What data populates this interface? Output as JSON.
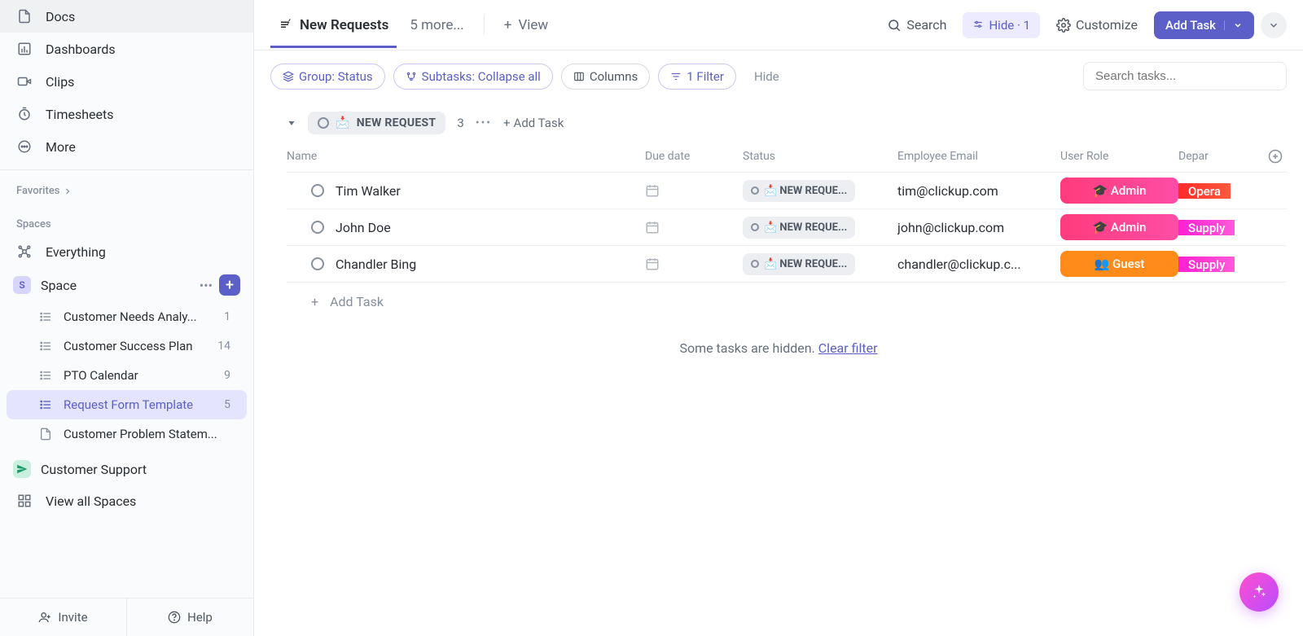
{
  "sidebar": {
    "nav": [
      {
        "icon": "doc",
        "label": "Docs"
      },
      {
        "icon": "dashboard",
        "label": "Dashboards"
      },
      {
        "icon": "clip",
        "label": "Clips"
      },
      {
        "icon": "timesheet",
        "label": "Timesheets"
      },
      {
        "icon": "more",
        "label": "More"
      }
    ],
    "favorites_label": "Favorites",
    "spaces_label": "Spaces",
    "everything_label": "Everything",
    "space": {
      "badge": "S",
      "badge_bg": "#d7d5fb",
      "badge_color": "#5b5fc7",
      "name": "Space"
    },
    "lists": [
      {
        "icon": "list",
        "label": "Customer Needs Analy...",
        "count": "1",
        "active": false
      },
      {
        "icon": "list",
        "label": "Customer Success Plan",
        "count": "14",
        "active": false
      },
      {
        "icon": "list",
        "label": "PTO Calendar",
        "count": "9",
        "active": false
      },
      {
        "icon": "list",
        "label": "Request Form Template",
        "count": "5",
        "active": true
      },
      {
        "icon": "doc",
        "label": "Customer Problem Statem...",
        "count": "",
        "active": false
      }
    ],
    "customer_support": {
      "label": "Customer Support",
      "badge_bg": "#c9f0df"
    },
    "view_all_spaces": "View all Spaces",
    "footer": {
      "invite": "Invite",
      "help": "Help"
    }
  },
  "tabs": {
    "active_label": "New Requests",
    "more_label": "5 more...",
    "view_label": "View"
  },
  "topbar": {
    "search": "Search",
    "hide": "Hide · 1",
    "customize": "Customize",
    "add_task": "Add Task"
  },
  "filters": {
    "group": "Group: Status",
    "subtasks": "Subtasks: Collapse all",
    "columns": "Columns",
    "filter": "1 Filter",
    "hide": "Hide",
    "search_placeholder": "Search tasks..."
  },
  "group": {
    "name": "NEW REQUEST",
    "emoji": "📩",
    "count": "3",
    "add_task": "Add Task"
  },
  "columns": {
    "name": "Name",
    "due": "Due date",
    "status": "Status",
    "email": "Employee Email",
    "role": "User Role",
    "dept": "Depar"
  },
  "rows": [
    {
      "name": "Tim Walker",
      "status": "NEW REQUE...",
      "email": "tim@clickup.com",
      "role": "🎓 Admin",
      "role_bg": "linear-gradient(90deg,#ff3b7b,#ff4da6)",
      "dept": "Opera",
      "dept_bg": "linear-gradient(90deg,#ff2a2a,#ff5a3c)"
    },
    {
      "name": "John Doe",
      "status": "NEW REQUE...",
      "email": "john@clickup.com",
      "role": "🎓 Admin",
      "role_bg": "linear-gradient(90deg,#ff3b7b,#ff4da6)",
      "dept": "Supply",
      "dept_bg": "linear-gradient(90deg,#ff1fd1,#ff5ad9)"
    },
    {
      "name": "Chandler Bing",
      "status": "NEW REQUE...",
      "email": "chandler@clickup.c...",
      "role": "👥 Guest",
      "role_bg": "#ff8c1a",
      "dept": "Supply",
      "dept_bg": "linear-gradient(90deg,#ff1fd1,#ff5ad9)"
    }
  ],
  "add_task_row": "Add Task",
  "hidden_msg": {
    "text": "Some tasks are hidden. ",
    "link": "Clear filter"
  }
}
